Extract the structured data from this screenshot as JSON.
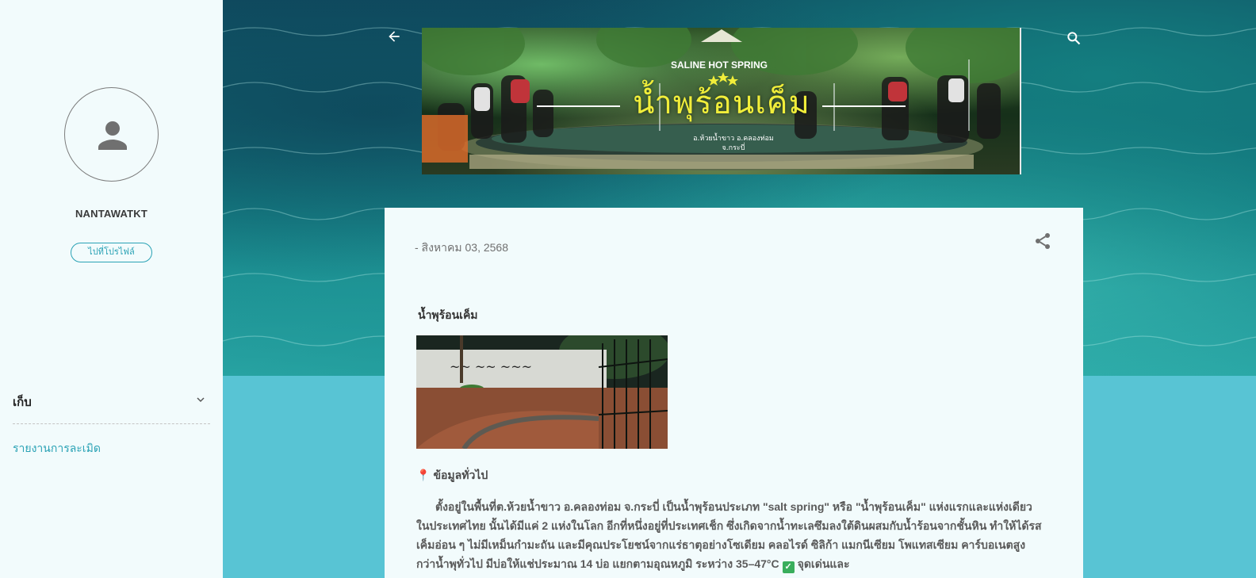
{
  "sidebar": {
    "username": "NANTAWATKT",
    "profile_button": "ไปที่โปรไฟล์",
    "archive_title": "เก็บ",
    "report_link": "รายงานการละเมิด"
  },
  "banner": {
    "arc_text": "SALINE HOT SPRING",
    "title": "น้ำพุร้อนเค็ม",
    "subtitle_line1": "อ.ห้วยน้ำขาว อ.คลองท่อม",
    "subtitle_line2": "จ.กระบี่",
    "title_color": "#f1ee3a"
  },
  "post": {
    "date": "- สิงหาคม 03, 2568",
    "title": "น้ำพุร้อนเค็ม",
    "section_heading": "ข้อมูลทั่วไป",
    "body_paragraph": "ตั้งอยู่ในพื้นที่ต.ห้วยน้ำขาว อ.คลองท่อม จ.กระบี่ เป็นน้ำพุร้อนประเภท \"salt spring\" หรือ \"น้ำพุร้อนเค็ม\" แห่งแรกและแห่งเดียวในประเทศไทย นั้นได้มีแค่ 2 แห่งในโลก อีกที่หนึ่งอยู่ที่ประเทศเช็ก  ซึ่งเกิดจากน้ำทะเลซึมลงใต้ดินผสมกับน้ำร้อนจากชั้นหิน ทำให้ได้รสเค็มอ่อน ๆ ไม่มีเหม็นกำมะถัน และมีคุณประโยชน์จากแร่ธาตุอย่างโซเดียม คลอไรด์ ซิลิก้า แมกนีเซียม โพแทสเซียม คาร์บอเนตสูงกว่าน้ำพุทั่วไป มีบ่อให้แช่ประมาณ 14 บ่อ แยกตามอุณหภูมิ ระหว่าง 35–47°C",
    "body_tail": "จุดเด่นและ"
  },
  "icons": {
    "back": "arrow-back-icon",
    "search": "search-icon",
    "share": "share-icon",
    "avatar": "person-icon",
    "archive_toggle": "chevron-down-icon",
    "pin": "map-pin-icon",
    "check": "check-box-icon"
  },
  "colors": {
    "accent": "#2aa2b5",
    "page_bg": "#58c4d4",
    "card_bg": "#f2fbfc"
  }
}
